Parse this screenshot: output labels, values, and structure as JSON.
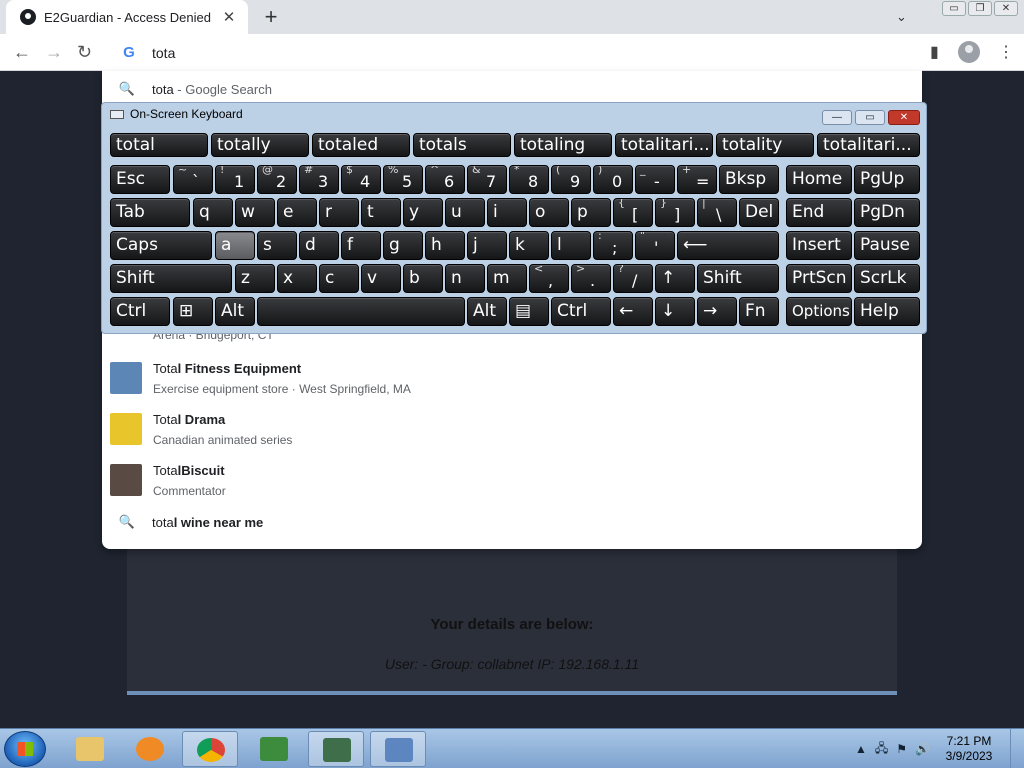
{
  "browser": {
    "tab_title": "E2Guardian - Access Denied",
    "tab_close": "✕",
    "new_tab": "+",
    "tab_search": "⌄",
    "window_buttons": [
      "▭",
      "❐",
      "✕"
    ],
    "nav": {
      "back": "←",
      "forward": "→",
      "reload": "↻"
    },
    "omnibox_value": "tota",
    "omnibox_g": "G",
    "side_panel": "▮",
    "menu": "⋮"
  },
  "suggestions": [
    {
      "type": "search",
      "icon": "🔍",
      "typed": "tota",
      "rest": " - Google Search"
    },
    {
      "type": "entity",
      "bold": "Total Fitness Equipment",
      "typed_prefix": "Tota",
      "subtitle": "Exercise equipment store · West Springfield, MA",
      "thumb_color": "#5b86b5"
    },
    {
      "type": "entity",
      "bold": "Total Drama",
      "typed_prefix": "Tota",
      "subtitle": "Canadian animated series",
      "thumb_color": "#e8c52a"
    },
    {
      "type": "entity",
      "bold": "TotalBiscuit",
      "typed_prefix": "Tota",
      "subtitle": "Commentator",
      "thumb_color": "#5a4a44"
    },
    {
      "type": "search",
      "icon": "🔍",
      "typed": "tota",
      "rest": "l wine near me"
    }
  ],
  "partial_row_subtitle": "Arena · Bridgeport, CT",
  "page": {
    "details_heading": "Your details are below:",
    "user_line": "User: -   Group: collabnet   IP: 192.168.1.11"
  },
  "osk": {
    "title": "On-Screen Keyboard",
    "controls": [
      "—",
      "▭",
      "✕"
    ],
    "predictions": [
      "total",
      "totally",
      "totaled",
      "totals",
      "totaling",
      "totalitari...",
      "totality",
      "totalitari..."
    ],
    "rows": [
      [
        {
          "l": "Esc"
        },
        {
          "s": "~",
          "m": "`"
        },
        {
          "s": "!",
          "m": "1"
        },
        {
          "s": "@",
          "m": "2"
        },
        {
          "s": "#",
          "m": "3"
        },
        {
          "s": "$",
          "m": "4"
        },
        {
          "s": "%",
          "m": "5"
        },
        {
          "s": "^",
          "m": "6"
        },
        {
          "s": "&",
          "m": "7"
        },
        {
          "s": "*",
          "m": "8"
        },
        {
          "s": "(",
          "m": "9"
        },
        {
          "s": ")",
          "m": "0"
        },
        {
          "s": "_",
          "m": "-"
        },
        {
          "s": "+",
          "m": "="
        },
        {
          "l": "Bksp"
        },
        {
          "l": "Home"
        },
        {
          "l": "PgUp"
        }
      ],
      [
        {
          "l": "Tab"
        },
        {
          "l": "q"
        },
        {
          "l": "w"
        },
        {
          "l": "e"
        },
        {
          "l": "r"
        },
        {
          "l": "t"
        },
        {
          "l": "y"
        },
        {
          "l": "u"
        },
        {
          "l": "i"
        },
        {
          "l": "o"
        },
        {
          "l": "p"
        },
        {
          "s": "{",
          "m": "["
        },
        {
          "s": "}",
          "m": "]"
        },
        {
          "s": "|",
          "m": "\\"
        },
        {
          "l": "Del"
        },
        {
          "l": "End"
        },
        {
          "l": "PgDn"
        }
      ],
      [
        {
          "l": "Caps"
        },
        {
          "l": "a"
        },
        {
          "l": "s"
        },
        {
          "l": "d"
        },
        {
          "l": "f"
        },
        {
          "l": "g"
        },
        {
          "l": "h"
        },
        {
          "l": "j"
        },
        {
          "l": "k"
        },
        {
          "l": "l"
        },
        {
          "s": ":",
          "m": ";"
        },
        {
          "s": "\"",
          "m": "'"
        },
        {
          "l": "⟵"
        },
        {
          "l": "Insert"
        },
        {
          "l": "Pause"
        }
      ],
      [
        {
          "l": "Shift"
        },
        {
          "l": "z"
        },
        {
          "l": "x"
        },
        {
          "l": "c"
        },
        {
          "l": "v"
        },
        {
          "l": "b"
        },
        {
          "l": "n"
        },
        {
          "l": "m"
        },
        {
          "s": "<",
          "m": ","
        },
        {
          "s": ">",
          "m": "."
        },
        {
          "s": "?",
          "m": "/"
        },
        {
          "l": "↑"
        },
        {
          "l": "Shift"
        },
        {
          "l": "PrtScn"
        },
        {
          "l": "ScrLk"
        }
      ],
      [
        {
          "l": "Ctrl"
        },
        {
          "l": "⊞"
        },
        {
          "l": "Alt"
        },
        {
          "l": ""
        },
        {
          "l": "Alt"
        },
        {
          "l": "▤"
        },
        {
          "l": "Ctrl"
        },
        {
          "l": "←"
        },
        {
          "l": "↓"
        },
        {
          "l": "→"
        },
        {
          "l": "Fn"
        },
        {
          "l": "Options"
        },
        {
          "l": "Help"
        }
      ]
    ],
    "hovered_key": "a"
  },
  "taskbar": {
    "time": "7:21 PM",
    "date": "3/9/2023",
    "tray_icons": [
      "▲",
      "🖧",
      "⚑",
      "🔊"
    ],
    "apps": [
      "explorer-icon",
      "media-player-icon",
      "chrome-icon",
      "csharp-icon",
      "task-manager-icon",
      "on-screen-keyboard-icon"
    ]
  }
}
